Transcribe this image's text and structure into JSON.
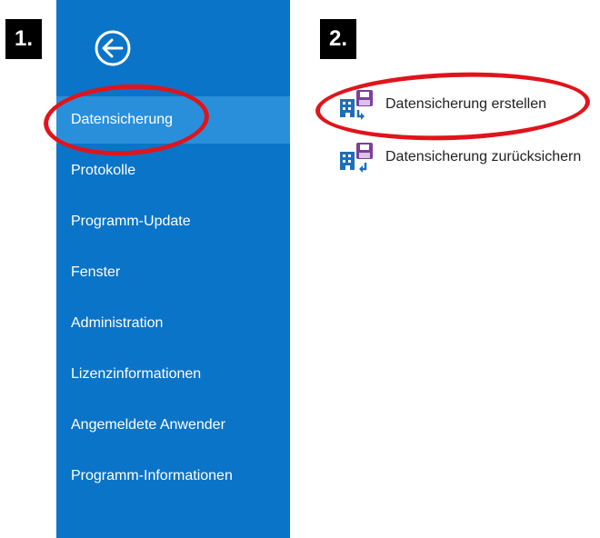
{
  "steps": {
    "one": "1.",
    "two": "2."
  },
  "back_button": {
    "icon": "back-arrow-circle-icon"
  },
  "sidebar": {
    "items": [
      {
        "label": "Datensicherung",
        "active": true
      },
      {
        "label": "Protokolle"
      },
      {
        "label": "Programm-Update"
      },
      {
        "label": "Fenster"
      },
      {
        "label": "Administration"
      },
      {
        "label": "Lizenzinformationen"
      },
      {
        "label": "Angemeldete Anwender"
      },
      {
        "label": "Programm-Informationen"
      }
    ]
  },
  "actions": {
    "items": [
      {
        "label": "Datensicherung erstellen",
        "icon": "database-save-icon"
      },
      {
        "label": "Datensicherung zurücksichern",
        "icon": "database-restore-icon"
      }
    ]
  },
  "colors": {
    "sidebar": "#0a74c8",
    "active_item": "#2a8fdb",
    "highlight": "#e0141b",
    "icon_purple": "#7d3f98",
    "icon_blue": "#1e6fb8"
  }
}
